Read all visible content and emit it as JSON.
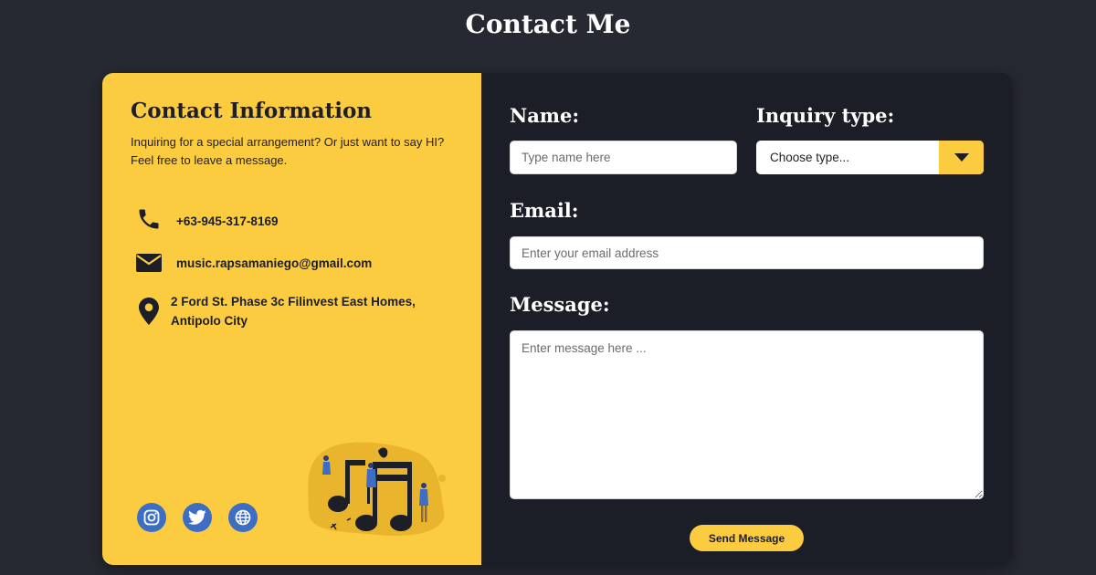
{
  "page": {
    "title": "Contact Me"
  },
  "info": {
    "heading": "Contact Information",
    "description": "Inquiring for a special arrangement? Or just want to say HI? Feel free to leave a message.",
    "phone": "+63-945-317-8169",
    "email": "music.rapsamaniego@gmail.com",
    "address": "2 Ford St. Phase 3c Filinvest East Homes, Antipolo City",
    "icons": {
      "phone": "phone-icon",
      "email": "envelope-icon",
      "address": "map-pin-icon"
    },
    "socials": [
      {
        "name": "instagram",
        "icon": "instagram-icon"
      },
      {
        "name": "twitter",
        "icon": "twitter-icon"
      },
      {
        "name": "website",
        "icon": "globe-icon"
      }
    ]
  },
  "form": {
    "name_label": "Name:",
    "name_placeholder": "Type name here",
    "inquiry_label": "Inquiry type:",
    "inquiry_selected": "Choose type...",
    "email_label": "Email:",
    "email_placeholder": "Enter your email address",
    "message_label": "Message:",
    "message_placeholder": "Enter message here ...",
    "submit_label": "Send Message"
  },
  "colors": {
    "background": "#262832",
    "accent": "#fbcb40",
    "form_panel": "#1c1e27",
    "social": "#3d6ec4",
    "text_dark": "#1d1e26"
  }
}
